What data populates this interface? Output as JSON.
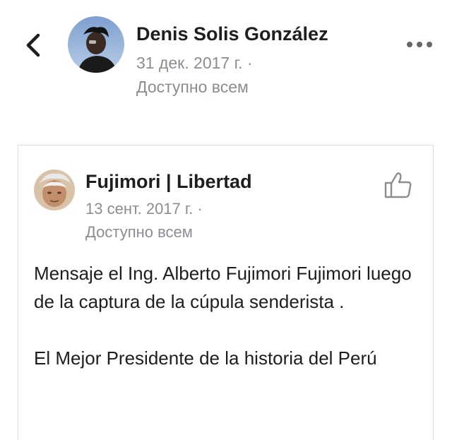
{
  "header": {
    "author_name": "Denis Solis González",
    "date": "31 дек. 2017 г. ·",
    "audience": "Доступно всем"
  },
  "shared_post": {
    "page_name": "Fujimori | Libertad",
    "date": "13 сент. 2017 г. ·",
    "audience": "Доступно всем",
    "paragraphs": [
      "Mensaje el Ing. Alberto Fujimori Fujimori luego de la captura de la cúpula senderista .",
      "El Mejor Presidente de la historia del Perú"
    ]
  },
  "icons": {
    "back": "chevron-left-icon",
    "more": "more-horizontal-icon",
    "like": "thumbs-up-icon"
  },
  "colors": {
    "text_primary": "#1c1e21",
    "text_secondary": "#8a8d91",
    "card_border": "#dadde1"
  }
}
